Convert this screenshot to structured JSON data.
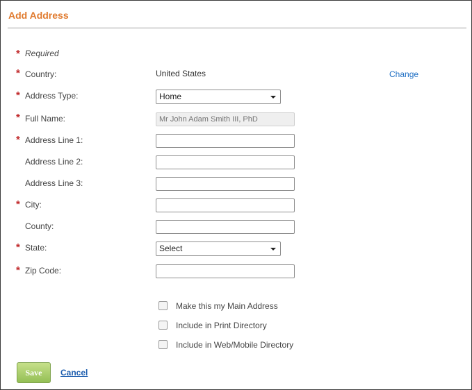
{
  "dialog": {
    "title": "Add Address"
  },
  "form": {
    "required_note": "Required",
    "country_label": "Country:",
    "country_value": "United States",
    "change_link": "Change",
    "address_type_label": "Address Type:",
    "address_type_selected": "Home",
    "full_name_label": "Full Name:",
    "full_name_placeholder": "Mr John Adam Smith III, PhD",
    "address_line1_label": "Address Line 1:",
    "address_line1_value": "",
    "address_line2_label": "Address Line 2:",
    "address_line2_value": "",
    "address_line3_label": "Address Line 3:",
    "address_line3_value": "",
    "city_label": "City:",
    "city_value": "",
    "county_label": "County:",
    "county_value": "",
    "state_label": "State:",
    "state_selected": "Select",
    "zip_label": "Zip Code:",
    "zip_value": ""
  },
  "options": {
    "main_address": {
      "label": "Make this my Main Address",
      "checked": false
    },
    "print_directory": {
      "label": "Include in Print Directory",
      "checked": false
    },
    "web_directory": {
      "label": "Include in Web/Mobile Directory",
      "checked": false
    }
  },
  "actions": {
    "save_label": "Save",
    "cancel_label": "Cancel"
  },
  "colors": {
    "title": "#e07a2e",
    "required_star": "#c0282a",
    "link": "#1f6fc4",
    "save_button": "#a8cc6a"
  }
}
